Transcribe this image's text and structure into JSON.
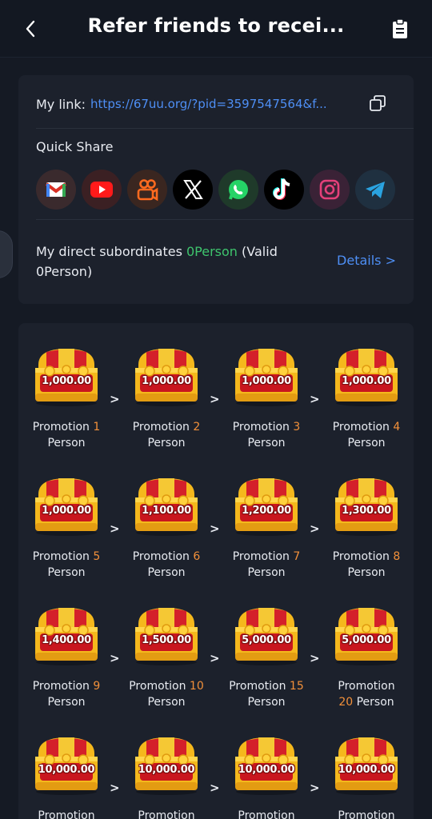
{
  "header": {
    "title": "Refer friends to recei..."
  },
  "link": {
    "label": "My link:",
    "url": "https://67uu.org/?pid=3597547564&f..."
  },
  "quick_share": {
    "label": "Quick Share",
    "icons": [
      "gmail-icon",
      "youtube-icon",
      "kwai-icon",
      "x-icon",
      "whatsapp-icon",
      "tiktok-icon",
      "instagram-icon",
      "telegram-icon"
    ]
  },
  "subordinates": {
    "prefix": "My direct subordinates",
    "count": "0Person",
    "suffix": "(Valid 0Person)",
    "details": "Details >"
  },
  "rewards": [
    {
      "amount": "1,000.00",
      "label": "Promotion",
      "num": "1",
      "unit": "Person"
    },
    {
      "amount": "1,000.00",
      "label": "Promotion",
      "num": "2",
      "unit": "Person"
    },
    {
      "amount": "1,000.00",
      "label": "Promotion",
      "num": "3",
      "unit": "Person"
    },
    {
      "amount": "1,000.00",
      "label": "Promotion",
      "num": "4",
      "unit": "Person"
    },
    {
      "amount": "1,000.00",
      "label": "Promotion",
      "num": "5",
      "unit": "Person"
    },
    {
      "amount": "1,100.00",
      "label": "Promotion",
      "num": "6",
      "unit": "Person"
    },
    {
      "amount": "1,200.00",
      "label": "Promotion",
      "num": "7",
      "unit": "Person"
    },
    {
      "amount": "1,300.00",
      "label": "Promotion",
      "num": "8",
      "unit": "Person"
    },
    {
      "amount": "1,400.00",
      "label": "Promotion",
      "num": "9",
      "unit": "Person"
    },
    {
      "amount": "1,500.00",
      "label": "Promotion",
      "num": "10",
      "unit": "Person"
    },
    {
      "amount": "5,000.00",
      "label": "Promotion",
      "num": "15",
      "unit": "Person"
    },
    {
      "amount": "5,000.00",
      "label": "Promotion",
      "num": "20",
      "unit": "Person"
    },
    {
      "amount": "10,000.00",
      "label": "Promotion",
      "num": "",
      "unit": ""
    },
    {
      "amount": "10,000.00",
      "label": "Promotion",
      "num": "",
      "unit": ""
    },
    {
      "amount": "10,000.00",
      "label": "Promotion",
      "num": "",
      "unit": ""
    },
    {
      "amount": "10,000.00",
      "label": "Promotion",
      "num": "",
      "unit": ""
    }
  ],
  "arrow_glyph": ">",
  "colors": {
    "accent_blue": "#4e8ff5",
    "accent_green": "#3ec46d",
    "accent_orange": "#f2903a",
    "background": "#151a24",
    "card": "#1c212c"
  }
}
